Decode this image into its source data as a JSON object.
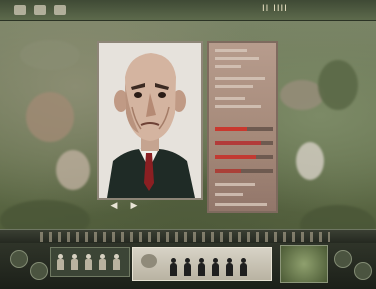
{
  "hud": {
    "coin_readout": "II  IIII"
  },
  "character": {
    "skills": [
      {
        "fill": 0.55,
        "color": "#c9382e"
      },
      {
        "fill": 0.8,
        "color": "#b23b3a"
      },
      {
        "fill": 0.7,
        "color": "#c23a32"
      },
      {
        "fill": 0.45,
        "color": "#aa4038"
      }
    ]
  },
  "navigation": {
    "prev_icon": "left-arrow-icon",
    "next_icon": "right-arrow-icon",
    "prev_glyph": "◀",
    "next_glyph": "▶"
  },
  "unit_bar": {
    "figure_count": 5,
    "selected_count": 6
  },
  "colors": {
    "card_bg": "#e6e2dc",
    "stats_bg": "#a48878",
    "suit": "#1f2b26",
    "tie": "#8b1f22"
  }
}
